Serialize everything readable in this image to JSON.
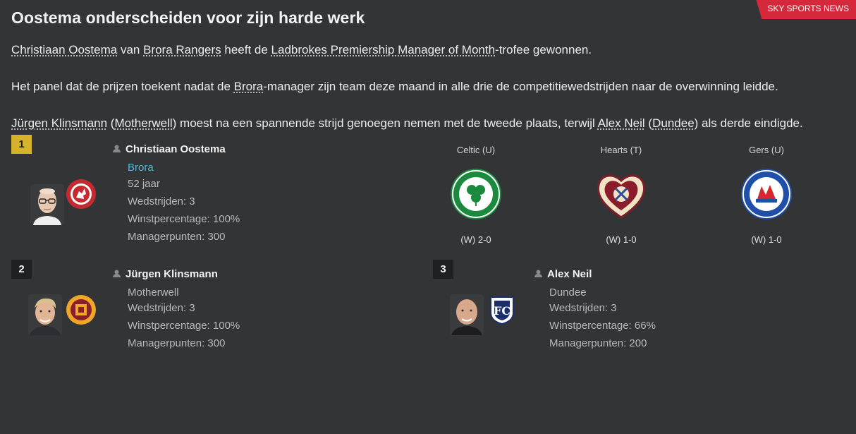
{
  "source": "SKY SPORTS NEWS",
  "headline": "Oostema onderscheiden voor zijn harde werk",
  "para1": {
    "manager": "Christiaan Oostema",
    "t1": " van ",
    "club": "Brora Rangers",
    "t2": " heeft de ",
    "award": "Ladbrokes Premiership Manager of Month",
    "t3": "-trofee gewonnen."
  },
  "para2": {
    "t1": "Het panel dat de prijzen toekent nadat de ",
    "club": "Brora",
    "t2": "-manager zijn team deze maand in alle drie de competitiewedstrijden naar de overwinning leidde."
  },
  "para3": {
    "manager2": "Jürgen Klinsmann",
    "p1": " (",
    "club2": "Motherwell",
    "t1": ") moest na een spannende strijd genoegen nemen met de tweede plaats, terwijl ",
    "manager3": "Alex Neil",
    "p2": " (",
    "club3": "Dundee",
    "t2": ") als derde eindigde."
  },
  "first": {
    "rank": "1",
    "name": "Christiaan Oostema",
    "club": "Brora",
    "age": "52 jaar",
    "matches": "Wedstrijden: 3",
    "winpct": "Winstpercentage: 100%",
    "points": "Managerpunten: 300",
    "results": [
      {
        "team": "Celtic (U)",
        "result": "(W) 2-0",
        "crest": "celtic-crest"
      },
      {
        "team": "Hearts (T)",
        "result": "(W) 1-0",
        "crest": "hearts-crest"
      },
      {
        "team": "Gers (U)",
        "result": "(W) 1-0",
        "crest": "rangers-crest"
      }
    ]
  },
  "second": {
    "rank": "2",
    "name": "Jürgen Klinsmann",
    "club": "Motherwell",
    "matches": "Wedstrijden: 3",
    "winpct": "Winstpercentage: 100%",
    "points": "Managerpunten: 300"
  },
  "third": {
    "rank": "3",
    "name": "Alex Neil",
    "club": "Dundee",
    "matches": "Wedstrijden: 3",
    "winpct": "Winstpercentage: 66%",
    "points": "Managerpunten: 200"
  },
  "colors": {
    "background": "#333436",
    "rank_gold": "#d7b22b",
    "link_blue": "#4fb8d8",
    "badge_red": "#d5283a"
  }
}
